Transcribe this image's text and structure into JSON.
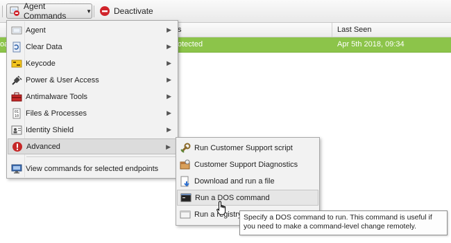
{
  "toolbar": {
    "agent_commands_label": "Agent Commands",
    "deactivate_label": "Deactivate"
  },
  "grid": {
    "columns": [
      "s",
      "Last Seen"
    ],
    "row": {
      "left_text": "oa",
      "status": "otected",
      "last_seen": "Apr 5th 2018, 09:34"
    },
    "row_color": "#8cc44a"
  },
  "menu": {
    "items": [
      {
        "label": "Agent",
        "icon": "agent-icon"
      },
      {
        "label": "Clear Data",
        "icon": "clear-data-icon"
      },
      {
        "label": "Keycode",
        "icon": "keycode-icon"
      },
      {
        "label": "Power & User Access",
        "icon": "plug-icon"
      },
      {
        "label": "Antimalware Tools",
        "icon": "toolbox-icon"
      },
      {
        "label": "Files & Processes",
        "icon": "files-icon"
      },
      {
        "label": "Identity Shield",
        "icon": "identity-shield-icon"
      },
      {
        "label": "Advanced",
        "icon": "warning-icon"
      },
      {
        "label": "View commands for selected endpoints",
        "icon": "monitor-icon"
      }
    ]
  },
  "submenu": {
    "items": [
      {
        "label": "Run Customer Support script",
        "icon": "wrench-icon"
      },
      {
        "label": "Customer Support Diagnostics",
        "icon": "diagnostics-icon"
      },
      {
        "label": "Download and run a file",
        "icon": "download-icon"
      },
      {
        "label": "Run a DOS command",
        "icon": "console-icon"
      },
      {
        "label": "Run a registry command",
        "icon": "registry-icon"
      }
    ]
  },
  "tooltip": {
    "text": "Specify a DOS command to run. This command is useful if you need to make a command-level change remotely."
  },
  "colors": {
    "accent_red": "#d0242b",
    "row_green": "#8cc44a"
  }
}
